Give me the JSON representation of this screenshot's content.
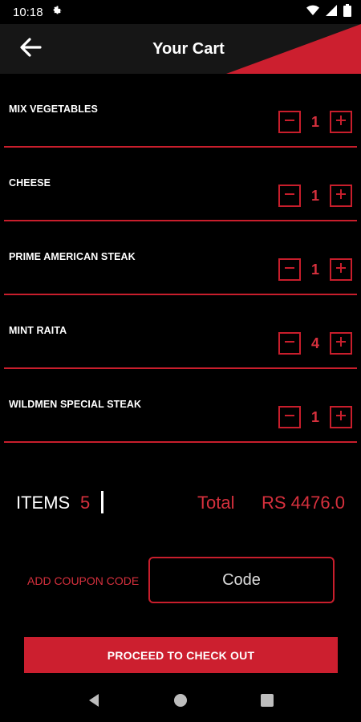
{
  "status": {
    "time": "10:18"
  },
  "header": {
    "title": "Your Cart",
    "accent_color": "#cc1f2f"
  },
  "cart": {
    "items": [
      {
        "name": "MIX VEGETABLES",
        "qty": "1"
      },
      {
        "name": "CHEESE",
        "qty": "1"
      },
      {
        "name": "PRIME AMERICAN STEAK",
        "qty": "1"
      },
      {
        "name": "MINT RAITA",
        "qty": "4"
      },
      {
        "name": "WILDMEN SPECIAL STEAK",
        "qty": "1"
      }
    ]
  },
  "summary": {
    "items_label": "ITEMS",
    "items_count": "5",
    "total_label": "Total",
    "total_value": "RS  4476.0"
  },
  "coupon": {
    "label": "ADD COUPON CODE",
    "placeholder": "Code"
  },
  "checkout": {
    "label": "PROCEED TO CHECK OUT"
  },
  "icons": {
    "back": "arrow-left-icon",
    "minus": "minus-icon",
    "plus": "plus-icon",
    "settings": "gear-icon",
    "wifi": "wifi-icon",
    "signal": "signal-icon",
    "battery": "battery-icon"
  }
}
